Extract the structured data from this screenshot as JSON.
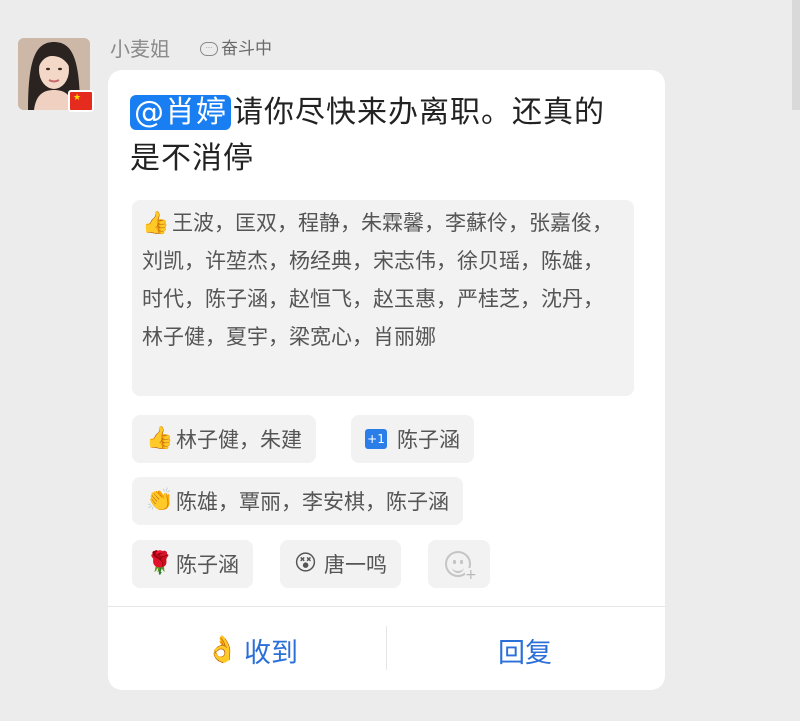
{
  "sender": {
    "name": "小麦姐",
    "status_icon": "speech-bubble-icon",
    "status": "奋斗中"
  },
  "message": {
    "mention": "@肖婷",
    "text": "请你尽快来办离职。还真的是不消停"
  },
  "reactions": {
    "thumbs_up_all": {
      "icon": "thumbs-up-icon",
      "names": "王波，匡双，程静，朱霖馨，李蘇伶，张嘉俊，刘凯，许堃杰，杨经典，宋志伟，徐贝瑶，陈雄，时代，陈子涵，赵恒飞，赵玉惠，严桂芝，沈丹，林子健，夏宇，梁宽心，肖丽娜"
    },
    "thumbs_up_small": {
      "icon": "thumbs-up-icon",
      "names": "林子健，朱建"
    },
    "plus_one": {
      "icon": "plus-one-icon",
      "label": "+1",
      "names": "陈子涵"
    },
    "clap": {
      "icon": "clapping-hands-icon",
      "names": "陈雄，覃丽，李安棋，陈子涵"
    },
    "rose": {
      "icon": "rose-icon",
      "names": "陈子涵"
    },
    "dizzy": {
      "icon": "dizzy-face-icon",
      "names": "唐一鸣"
    },
    "add_icon": "add-emoji-icon"
  },
  "actions": {
    "ack_icon": "ok-hand-icon",
    "ack": "收到",
    "reply": "回复"
  },
  "colors": {
    "accent": "#1a7ef3",
    "link": "#2b6fd8",
    "card": "#ffffff",
    "background": "#ececec"
  }
}
